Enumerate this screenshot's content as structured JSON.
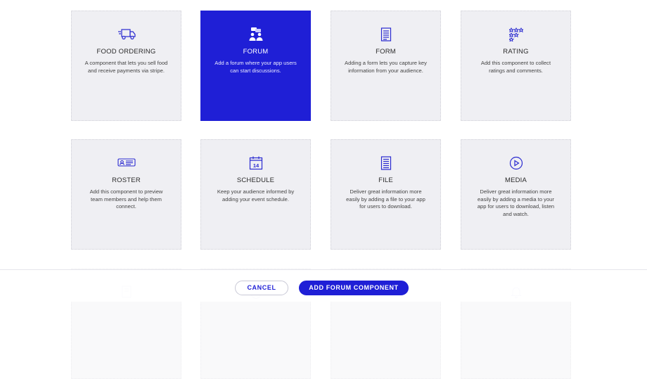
{
  "colors": {
    "accent": "#1f1fd6",
    "card_bg": "#efeff3"
  },
  "cards": [
    {
      "title": "FOOD ORDERING",
      "desc": "A component that lets you sell food and receive payments via stripe.",
      "icon": "truck-icon"
    },
    {
      "title": "FORUM",
      "desc": "Add a forum where your app users can start discussions.",
      "icon": "people-chat-icon",
      "selected": true
    },
    {
      "title": "FORM",
      "desc": "Adding a form lets you capture key information from your audience.",
      "icon": "form-icon"
    },
    {
      "title": "RATING",
      "desc": "Add this component to collect ratings and comments.",
      "icon": "stars-icon"
    },
    {
      "title": "ROSTER",
      "desc": "Add this component to preview team members and help them connect.",
      "icon": "id-card-icon"
    },
    {
      "title": "SCHEDULE",
      "desc": "Keep your audience informed by adding your event schedule.",
      "icon": "calendar-icon",
      "calendar_day": "14"
    },
    {
      "title": "FILE",
      "desc": "Deliver great information more easily by adding a file to your app for users to download.",
      "icon": "file-icon"
    },
    {
      "title": "MEDIA",
      "desc": "Deliver great information more easily by adding a media to your app for users to download, listen and watch.",
      "icon": "play-icon"
    }
  ],
  "footer": {
    "cancel_label": "CANCEL",
    "add_label": "ADD FORUM COMPONENT"
  }
}
